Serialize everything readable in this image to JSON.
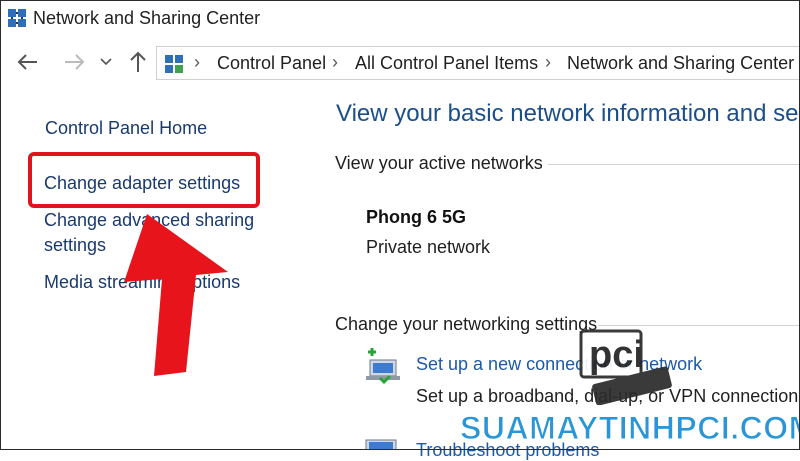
{
  "window": {
    "title": "Network and Sharing Center"
  },
  "address": {
    "breadcrumbs": [
      "Control Panel",
      "All Control Panel Items",
      "Network and Sharing Center"
    ],
    "back_icon": "back-arrow-icon",
    "forward_icon": "forward-arrow-icon",
    "recent_icon": "chevron-down-icon",
    "up_icon": "up-arrow-icon"
  },
  "sidebar": {
    "items": [
      {
        "label": "Control Panel Home"
      },
      {
        "label": "Change adapter settings"
      },
      {
        "label": "Change advanced sharing",
        "label2": "settings"
      },
      {
        "label": "Media streaming options"
      }
    ]
  },
  "main": {
    "heading": "View your basic network information and se",
    "active_networks_label": "View your active networks",
    "network": {
      "name": "Phong 6 5G",
      "type": "Private network"
    },
    "change_settings_label": "Change your networking settings",
    "tasks": [
      {
        "link": "Set up a new connection or network",
        "desc": "Set up a broadband, dial-up, or VPN connection"
      },
      {
        "link": "Troubleshoot problems"
      }
    ]
  },
  "overlay": {
    "watermark": "SUAMAYTINHPCI.COM",
    "logo_text": "pci",
    "highlight_color": "#e0141c"
  }
}
